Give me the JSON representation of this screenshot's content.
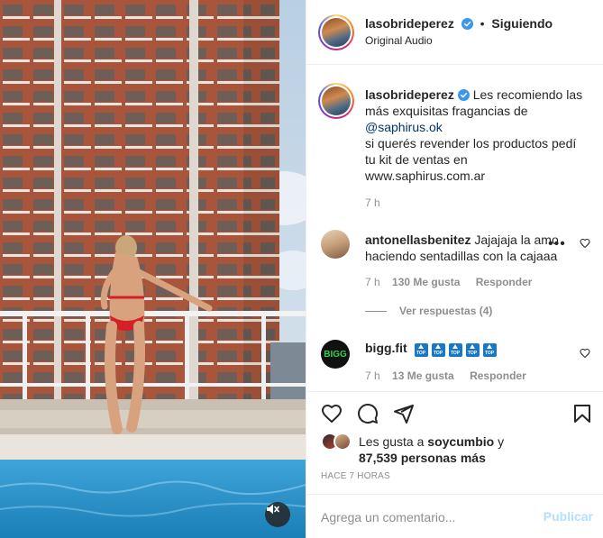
{
  "post": {
    "author": "lasobrideperez",
    "follow_state": "Siguiendo",
    "audio": "Original Audio",
    "caption": {
      "line1": "Les recomiendo las",
      "line2": "más exquisitas fragancias de",
      "mention": "@saphirus.ok",
      "line3": "si querés revender los productos pedí",
      "line4": "tu kit de ventas en",
      "link": "www.saphirus.com.ar"
    },
    "caption_time": "7 h"
  },
  "comments": [
    {
      "username": "antonellasbenitez",
      "text_line1": "Jajajaja la amo",
      "text_line2": "haciendo sentadillas con la cajaaa",
      "time": "7 h",
      "likes": "130 Me gusta",
      "reply": "Responder",
      "view_replies": "Ver respuestas (4)"
    },
    {
      "username": "bigg.fit",
      "avatar_text": "BIGG",
      "badges": [
        "TOP",
        "TOP",
        "TOP",
        "TOP",
        "TOP"
      ],
      "time": "7 h",
      "likes": "13 Me gusta",
      "reply": "Responder"
    }
  ],
  "likes": {
    "prefix": "Les gusta a",
    "user": "soycumbio",
    "joiner": "y",
    "count_text": "87,539 personas más"
  },
  "time_ago": "HACE 7 HORAS",
  "add_comment": {
    "placeholder": "Agrega un comentario...",
    "publish": "Publicar"
  },
  "icons": {
    "verified": "verified-badge-icon",
    "heart": "heart-icon",
    "comment": "comment-icon",
    "share": "share-icon",
    "save": "bookmark-icon",
    "mute": "muted-speaker-icon",
    "more": "more-options-icon"
  },
  "colors": {
    "verified": "#3897f0",
    "mention": "#00376b",
    "secondary_text": "#8e8e8e",
    "publish_disabled": "#b2dffc",
    "badge_blue": "#1877c9",
    "bigg_green": "#2fd14f"
  }
}
